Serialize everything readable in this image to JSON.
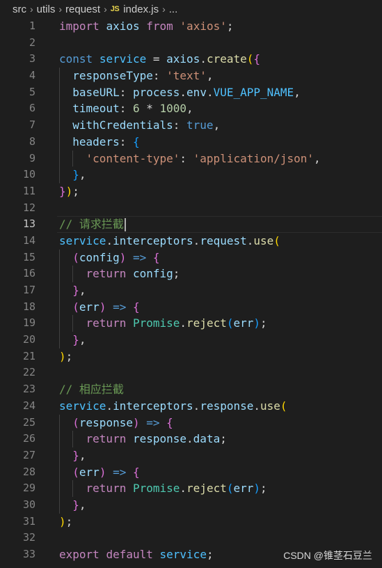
{
  "breadcrumb": {
    "items": [
      "src",
      "utils",
      "request"
    ],
    "file_icon": "JS",
    "file": "index.js",
    "tail": "..."
  },
  "watermark": "CSDN @锥茎石豆兰",
  "current_line": 13,
  "colors": {
    "background": "#1e1e1e",
    "keyword": "#c586c0",
    "storage": "#569cd6",
    "string": "#ce9178",
    "variable": "#4fc1ff",
    "property": "#9cdcfe",
    "function": "#dcdcaa",
    "number": "#b5cea8",
    "class": "#4ec9b0",
    "comment": "#6a9955"
  },
  "lines": [
    [
      [
        "kw",
        "import"
      ],
      [
        "p",
        " "
      ],
      [
        "prop",
        "axios"
      ],
      [
        "p",
        " "
      ],
      [
        "kw",
        "from"
      ],
      [
        "p",
        " "
      ],
      [
        "str",
        "'axios'"
      ],
      [
        "p",
        ";"
      ]
    ],
    [],
    [
      [
        "st",
        "const"
      ],
      [
        "p",
        " "
      ],
      [
        "var",
        "service"
      ],
      [
        "p",
        " = "
      ],
      [
        "prop",
        "axios"
      ],
      [
        "p",
        "."
      ],
      [
        "fn",
        "create"
      ],
      [
        "br1",
        "("
      ],
      [
        "br2",
        "{"
      ]
    ],
    [
      [
        "p",
        "  "
      ],
      [
        "prop",
        "responseType"
      ],
      [
        "p",
        ": "
      ],
      [
        "str",
        "'text'"
      ],
      [
        "p",
        ","
      ]
    ],
    [
      [
        "p",
        "  "
      ],
      [
        "prop",
        "baseURL"
      ],
      [
        "p",
        ": "
      ],
      [
        "prop",
        "process"
      ],
      [
        "p",
        "."
      ],
      [
        "prop",
        "env"
      ],
      [
        "p",
        "."
      ],
      [
        "var",
        "VUE_APP_NAME"
      ],
      [
        "p",
        ","
      ]
    ],
    [
      [
        "p",
        "  "
      ],
      [
        "prop",
        "timeout"
      ],
      [
        "p",
        ": "
      ],
      [
        "num",
        "6"
      ],
      [
        "p",
        " * "
      ],
      [
        "num",
        "1000"
      ],
      [
        "p",
        ","
      ]
    ],
    [
      [
        "p",
        "  "
      ],
      [
        "prop",
        "withCredentials"
      ],
      [
        "p",
        ": "
      ],
      [
        "st",
        "true"
      ],
      [
        "p",
        ","
      ]
    ],
    [
      [
        "p",
        "  "
      ],
      [
        "prop",
        "headers"
      ],
      [
        "p",
        ": "
      ],
      [
        "br3",
        "{"
      ]
    ],
    [
      [
        "p",
        "    "
      ],
      [
        "str",
        "'content-type'"
      ],
      [
        "p",
        ": "
      ],
      [
        "str",
        "'application/json'"
      ],
      [
        "p",
        ","
      ]
    ],
    [
      [
        "p",
        "  "
      ],
      [
        "br3",
        "}"
      ],
      [
        "p",
        ","
      ]
    ],
    [
      [
        "br2",
        "}"
      ],
      [
        "br1",
        ")"
      ],
      [
        "p",
        ";"
      ]
    ],
    [],
    [
      [
        "cm",
        "// 请求拦截"
      ]
    ],
    [
      [
        "var",
        "service"
      ],
      [
        "p",
        "."
      ],
      [
        "prop",
        "interceptors"
      ],
      [
        "p",
        "."
      ],
      [
        "prop",
        "request"
      ],
      [
        "p",
        "."
      ],
      [
        "fn",
        "use"
      ],
      [
        "br1",
        "("
      ]
    ],
    [
      [
        "p",
        "  "
      ],
      [
        "br2",
        "("
      ],
      [
        "prop",
        "config"
      ],
      [
        "br2",
        ")"
      ],
      [
        "p",
        " "
      ],
      [
        "st",
        "=>"
      ],
      [
        "p",
        " "
      ],
      [
        "br2",
        "{"
      ]
    ],
    [
      [
        "p",
        "    "
      ],
      [
        "kw",
        "return"
      ],
      [
        "p",
        " "
      ],
      [
        "prop",
        "config"
      ],
      [
        "p",
        ";"
      ]
    ],
    [
      [
        "p",
        "  "
      ],
      [
        "br2",
        "}"
      ],
      [
        "p",
        ","
      ]
    ],
    [
      [
        "p",
        "  "
      ],
      [
        "br2",
        "("
      ],
      [
        "prop",
        "err"
      ],
      [
        "br2",
        ")"
      ],
      [
        "p",
        " "
      ],
      [
        "st",
        "=>"
      ],
      [
        "p",
        " "
      ],
      [
        "br2",
        "{"
      ]
    ],
    [
      [
        "p",
        "    "
      ],
      [
        "kw",
        "return"
      ],
      [
        "p",
        " "
      ],
      [
        "cls",
        "Promise"
      ],
      [
        "p",
        "."
      ],
      [
        "fn",
        "reject"
      ],
      [
        "br3",
        "("
      ],
      [
        "prop",
        "err"
      ],
      [
        "br3",
        ")"
      ],
      [
        "p",
        ";"
      ]
    ],
    [
      [
        "p",
        "  "
      ],
      [
        "br2",
        "}"
      ],
      [
        "p",
        ","
      ]
    ],
    [
      [
        "br1",
        ")"
      ],
      [
        "p",
        ";"
      ]
    ],
    [],
    [
      [
        "cm",
        "// 相应拦截"
      ]
    ],
    [
      [
        "var",
        "service"
      ],
      [
        "p",
        "."
      ],
      [
        "prop",
        "interceptors"
      ],
      [
        "p",
        "."
      ],
      [
        "prop",
        "response"
      ],
      [
        "p",
        "."
      ],
      [
        "fn",
        "use"
      ],
      [
        "br1",
        "("
      ]
    ],
    [
      [
        "p",
        "  "
      ],
      [
        "br2",
        "("
      ],
      [
        "prop",
        "response"
      ],
      [
        "br2",
        ")"
      ],
      [
        "p",
        " "
      ],
      [
        "st",
        "=>"
      ],
      [
        "p",
        " "
      ],
      [
        "br2",
        "{"
      ]
    ],
    [
      [
        "p",
        "    "
      ],
      [
        "kw",
        "return"
      ],
      [
        "p",
        " "
      ],
      [
        "prop",
        "response"
      ],
      [
        "p",
        "."
      ],
      [
        "prop",
        "data"
      ],
      [
        "p",
        ";"
      ]
    ],
    [
      [
        "p",
        "  "
      ],
      [
        "br2",
        "}"
      ],
      [
        "p",
        ","
      ]
    ],
    [
      [
        "p",
        "  "
      ],
      [
        "br2",
        "("
      ],
      [
        "prop",
        "err"
      ],
      [
        "br2",
        ")"
      ],
      [
        "p",
        " "
      ],
      [
        "st",
        "=>"
      ],
      [
        "p",
        " "
      ],
      [
        "br2",
        "{"
      ]
    ],
    [
      [
        "p",
        "    "
      ],
      [
        "kw",
        "return"
      ],
      [
        "p",
        " "
      ],
      [
        "cls",
        "Promise"
      ],
      [
        "p",
        "."
      ],
      [
        "fn",
        "reject"
      ],
      [
        "br3",
        "("
      ],
      [
        "prop",
        "err"
      ],
      [
        "br3",
        ")"
      ],
      [
        "p",
        ";"
      ]
    ],
    [
      [
        "p",
        "  "
      ],
      [
        "br2",
        "}"
      ],
      [
        "p",
        ","
      ]
    ],
    [
      [
        "br1",
        ")"
      ],
      [
        "p",
        ";"
      ]
    ],
    [],
    [
      [
        "kw",
        "export"
      ],
      [
        "p",
        " "
      ],
      [
        "kw",
        "default"
      ],
      [
        "p",
        " "
      ],
      [
        "var",
        "service"
      ],
      [
        "p",
        ";"
      ]
    ]
  ]
}
